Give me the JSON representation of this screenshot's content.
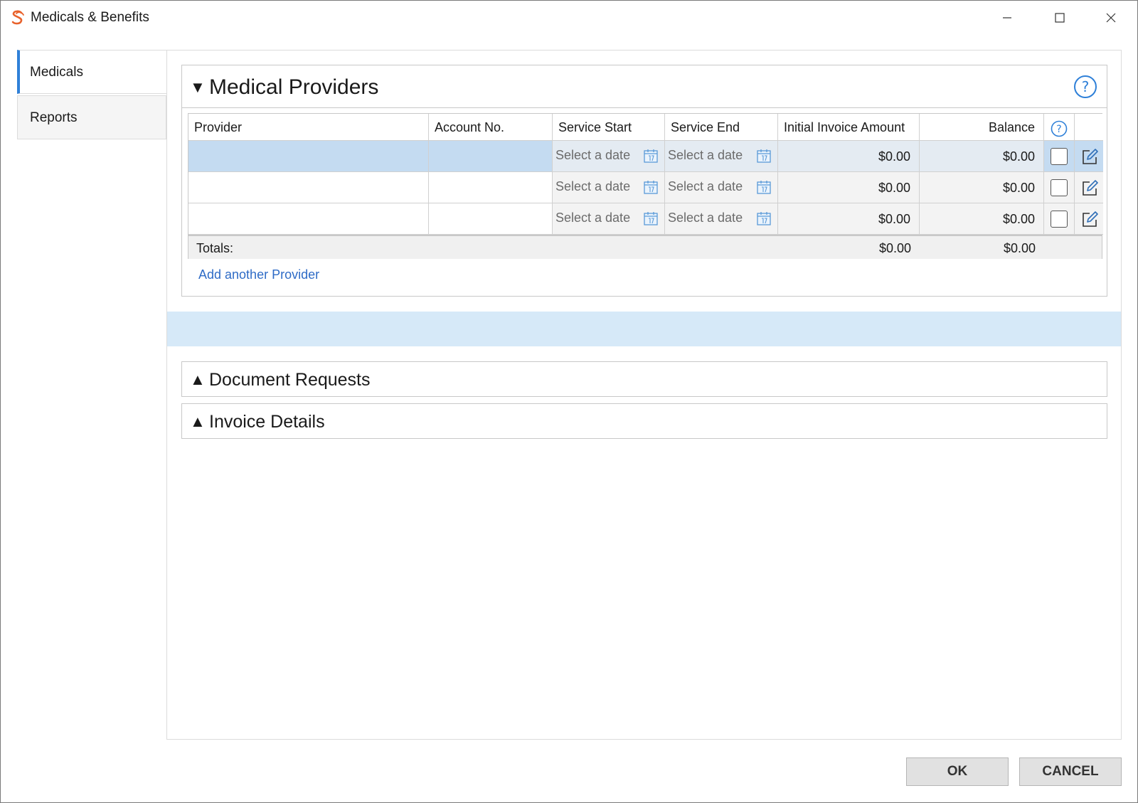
{
  "window": {
    "title": "Medicals & Benefits",
    "accent_color": "#2f80d8",
    "logo_color": "#e8622c"
  },
  "sidebar": {
    "items": [
      {
        "label": "Medicals",
        "active": true
      },
      {
        "label": "Reports",
        "active": false
      }
    ]
  },
  "medical_providers": {
    "title": "Medical Providers",
    "expanded": true,
    "columns": {
      "provider": "Provider",
      "account_no": "Account No.",
      "service_start": "Service Start",
      "service_end": "Service End",
      "initial_invoice_amount": "Initial Invoice Amount",
      "balance": "Balance"
    },
    "rows": [
      {
        "provider": "",
        "account_no": "",
        "service_start": "Select a date",
        "service_end": "Select a date",
        "initial_invoice_amount": "$0.00",
        "balance": "$0.00",
        "checked": false,
        "selected": true
      },
      {
        "provider": "",
        "account_no": "",
        "service_start": "Select a date",
        "service_end": "Select a date",
        "initial_invoice_amount": "$0.00",
        "balance": "$0.00",
        "checked": false,
        "selected": false
      },
      {
        "provider": "",
        "account_no": "",
        "service_start": "Select a date",
        "service_end": "Select a date",
        "initial_invoice_amount": "$0.00",
        "balance": "$0.00",
        "checked": false,
        "selected": false
      }
    ],
    "totals": {
      "label": "Totals:",
      "initial_invoice_amount": "$0.00",
      "balance": "$0.00"
    },
    "add_link": "Add another Provider"
  },
  "sections": {
    "document_requests": {
      "title": "Document Requests",
      "expanded": false
    },
    "invoice_details": {
      "title": "Invoice Details",
      "expanded": false
    }
  },
  "footer": {
    "ok_label": "OK",
    "cancel_label": "CANCEL"
  },
  "icons": {
    "expanded_caret": "▼",
    "collapsed_caret": "▲"
  }
}
